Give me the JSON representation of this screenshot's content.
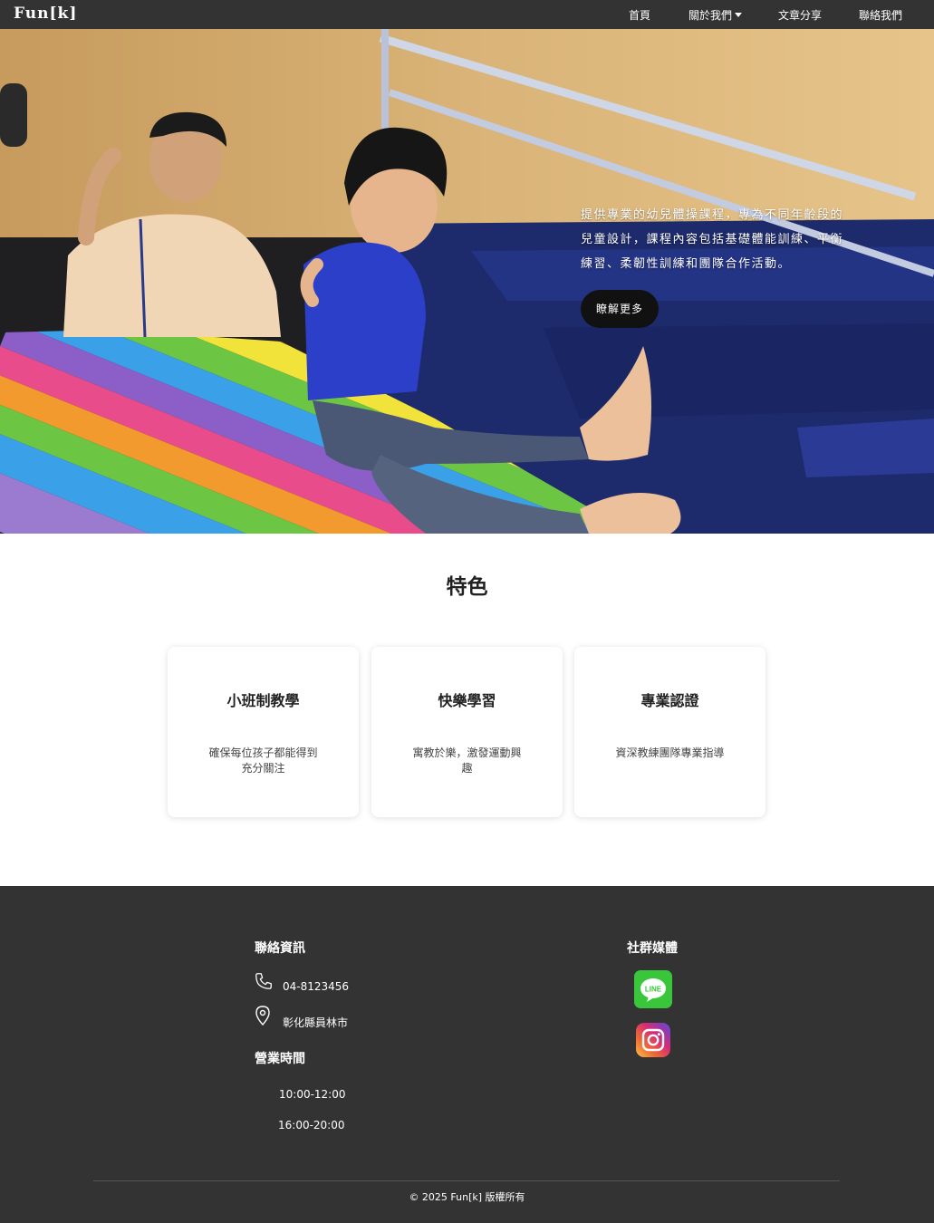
{
  "navbar": {
    "brand": "Fun[k]",
    "items": [
      {
        "label": "首頁"
      },
      {
        "label": "關於我們"
      },
      {
        "label": "文章分享"
      },
      {
        "label": "聯絡我們"
      }
    ]
  },
  "hero": {
    "description": "提供專業的幼兒體操課程，專為不同年齡段的兒童設計，課程內容包括基礎體能訓練、平衡練習、柔韌性訓練和團隊合作活動。",
    "button_label": "瞭解更多"
  },
  "features": {
    "title": "特色",
    "cards": [
      {
        "title": "小班制教學",
        "description": "確保每位孩子都能得到充分關注"
      },
      {
        "title": "快樂學習",
        "description": "寓教於樂，激發運動興趣"
      },
      {
        "title": "專業認證",
        "description": "資深教練團隊專業指導"
      }
    ]
  },
  "footer": {
    "contact_heading": "聯絡資訊",
    "phone": "04-8123456",
    "address": "彰化縣員林市",
    "hours_heading": "營業時間",
    "hours": [
      "10:00-12:00",
      "16:00-20:00"
    ],
    "social_heading": "社群媒體",
    "line_text": "LINE",
    "copyright": "© 2025 Fun[k] 版權所有"
  },
  "colors": {
    "navbar_bg": "#333333",
    "footer_bg": "#333333",
    "button_bg": "#111111",
    "line_green": "#3ac63a"
  },
  "icons": [
    "phone-icon",
    "map-pin-icon",
    "line-icon",
    "instagram-icon",
    "chevron-down-icon"
  ]
}
